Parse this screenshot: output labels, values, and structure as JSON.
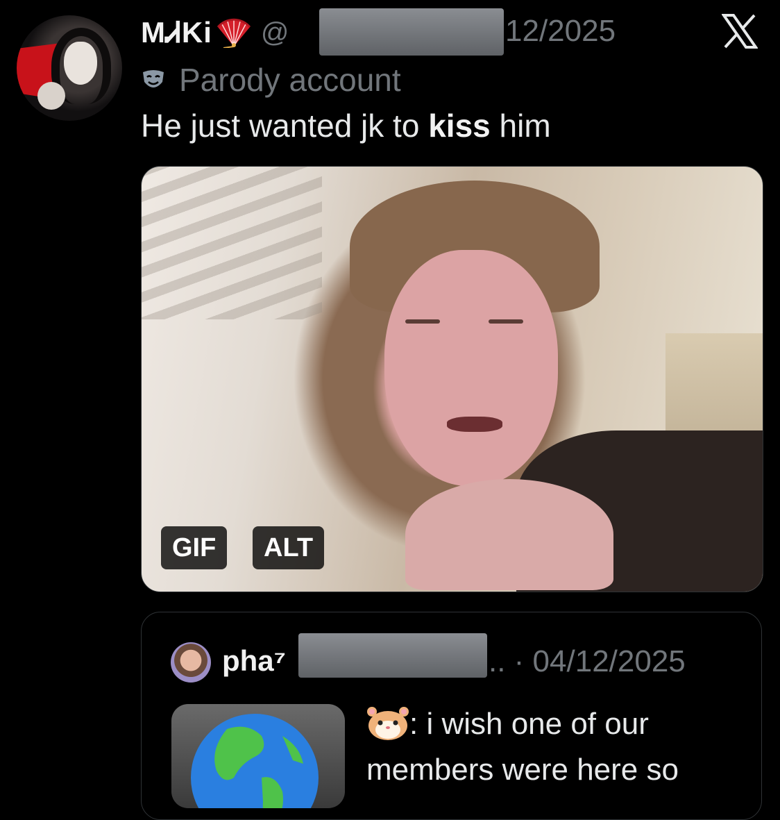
{
  "tweet": {
    "display_name": "MᏗKi",
    "handle_prefix": "@",
    "date_visible": "12/2025",
    "parody_label": "Parody account",
    "text_before": "He just wanted jk to ",
    "text_bold": "kiss",
    "text_after": " him",
    "media": {
      "badge_gif": "GIF",
      "badge_alt": "ALT"
    }
  },
  "quoted_tweet": {
    "name": "pha⁷",
    "meta": ".. · 04/12/2025",
    "text_after_icon": ": i wish one of our members were here so"
  },
  "icons": {
    "fan": "folding-fan-icon",
    "x_logo": "x-logo-icon",
    "mask": "parody-mask-icon",
    "hamster": "hamster-face-icon",
    "globe": "globe-americas-icon"
  },
  "colors": {
    "background": "#000000",
    "text_primary": "#e7e9ea",
    "text_secondary": "#71767b",
    "border": "#2f3336"
  }
}
